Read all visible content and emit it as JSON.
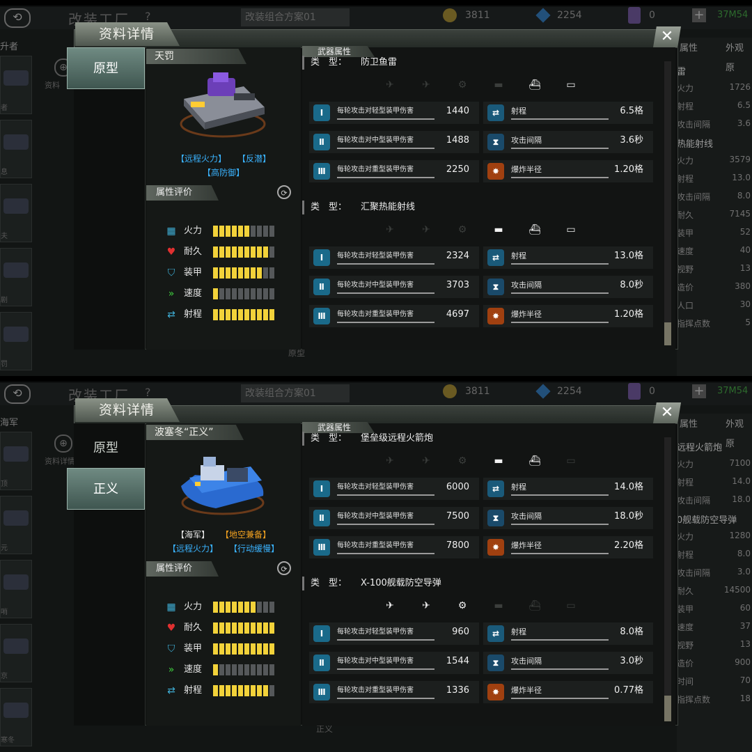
{
  "panels": [
    {
      "background": {
        "title": "改装工厂",
        "help": "?",
        "scheme": "改装组合方案01",
        "coins": "3811",
        "gems": "2254",
        "cards": "0",
        "power": "37M54",
        "filter": "升者",
        "zoom_label": "资料",
        "left_items": [
          "者",
          "息",
          "夫",
          "剧",
          "罚"
        ],
        "right_tabs": [
          "属性",
          "外观原"
        ],
        "right_rows": [
          {
            "k": "雷",
            "v": "",
            "head": true
          },
          {
            "k": "火力",
            "v": "1726"
          },
          {
            "k": "射程",
            "v": "6.5"
          },
          {
            "k": "攻击间隔",
            "v": "3.6"
          },
          {
            "k": "热能射线",
            "v": "",
            "head": true
          },
          {
            "k": "火力",
            "v": "3579"
          },
          {
            "k": "射程",
            "v": "13.0"
          },
          {
            "k": "攻击间隔",
            "v": "8.0"
          },
          {
            "k": "耐久",
            "v": "7145"
          },
          {
            "k": "装甲",
            "v": "52"
          },
          {
            "k": "速度",
            "v": "40"
          },
          {
            "k": "视野",
            "v": "13"
          },
          {
            "k": "造价",
            "v": "380"
          },
          {
            "k": "人口",
            "v": "30"
          },
          {
            "k": "指挥点数",
            "v": "5"
          }
        ],
        "under_label": "原型"
      },
      "dialog": {
        "title": "资料详情",
        "close": "✕",
        "variants": [
          {
            "label": "原型",
            "active": true
          }
        ],
        "unit": {
          "name": "天罚",
          "image": "purple-tank",
          "tags_line1": [
            {
              "text": "【远程火力】",
              "color": "blue"
            },
            {
              "text": "【反潜】",
              "color": "blue"
            }
          ],
          "tags_line2": [
            {
              "text": "【高防御】",
              "color": "blue"
            }
          ]
        },
        "attr_header": "属性评价",
        "attrs": [
          {
            "icon": "firepower-icon",
            "glyph": "▦",
            "label": "火力",
            "value": 6,
            "color": "#3fb0d8"
          },
          {
            "icon": "heart-icon",
            "glyph": "♥",
            "label": "耐久",
            "value": 9,
            "color": "#e03030"
          },
          {
            "icon": "armor-icon",
            "glyph": "⛉",
            "label": "装甲",
            "value": 8,
            "color": "#3fb0d8"
          },
          {
            "icon": "speed-icon",
            "glyph": "»",
            "label": "速度",
            "value": 1,
            "color": "#3fcf3f"
          },
          {
            "icon": "range-icon",
            "glyph": "⇄",
            "label": "射程",
            "value": 10,
            "color": "#3fb0d8"
          }
        ],
        "weapons_header": "武器属性",
        "type_key": "类　型：",
        "weapons": [
          {
            "type": "防卫鱼雷",
            "targets": [
              false,
              false,
              false,
              false,
              true,
              true
            ],
            "stats": [
              {
                "l_label": "每轮攻击对轻型装甲伤害",
                "l_value": "1440",
                "r_icon": "range",
                "r_label": "射程",
                "r_value": "6.5格"
              },
              {
                "l_label": "每轮攻击对中型装甲伤害",
                "l_value": "1488",
                "r_icon": "hourglass",
                "r_label": "攻击间隔",
                "r_value": "3.6秒"
              },
              {
                "l_label": "每轮攻击对重型装甲伤害",
                "l_value": "2250",
                "r_icon": "blast",
                "r_label": "爆炸半径",
                "r_value": "1.20格"
              }
            ]
          },
          {
            "type": "汇聚热能射线",
            "targets": [
              false,
              false,
              false,
              true,
              true,
              true
            ],
            "stats": [
              {
                "l_label": "每轮攻击对轻型装甲伤害",
                "l_value": "2324",
                "r_icon": "range",
                "r_label": "射程",
                "r_value": "13.0格"
              },
              {
                "l_label": "每轮攻击对中型装甲伤害",
                "l_value": "3703",
                "r_icon": "hourglass",
                "r_label": "攻击间隔",
                "r_value": "8.0秒"
              },
              {
                "l_label": "每轮攻击对重型装甲伤害",
                "l_value": "4697",
                "r_icon": "blast",
                "r_label": "爆炸半径",
                "r_value": "1.20格"
              }
            ]
          }
        ]
      }
    },
    {
      "background": {
        "title": "改装工厂",
        "help": "?",
        "scheme": "改装组合方案01",
        "coins": "3811",
        "gems": "2254",
        "cards": "0",
        "power": "37M54",
        "filter": "海军",
        "zoom_label": "资料详情",
        "left_items": [
          "顶",
          "元",
          "哨",
          "京",
          "寒冬"
        ],
        "right_tabs": [
          "属性",
          "外观原"
        ],
        "right_rows": [
          {
            "k": "远程火箭炮",
            "v": "",
            "head": true
          },
          {
            "k": "火力",
            "v": "7100"
          },
          {
            "k": "射程",
            "v": "14.0"
          },
          {
            "k": "攻击间隔",
            "v": "18.0"
          },
          {
            "k": "0舰载防空导弹",
            "v": "",
            "head": true
          },
          {
            "k": "火力",
            "v": "1280"
          },
          {
            "k": "射程",
            "v": "8.0"
          },
          {
            "k": "攻击间隔",
            "v": "3.0"
          },
          {
            "k": "耐久",
            "v": "14500"
          },
          {
            "k": "装甲",
            "v": "60"
          },
          {
            "k": "速度",
            "v": "37"
          },
          {
            "k": "视野",
            "v": "13"
          },
          {
            "k": "造价",
            "v": "900"
          },
          {
            "k": "时间",
            "v": "70"
          },
          {
            "k": "指挥点数",
            "v": "18"
          }
        ],
        "under_label": "正义"
      },
      "dialog": {
        "title": "资料详情",
        "close": "✕",
        "variants": [
          {
            "label": "原型",
            "active": false
          },
          {
            "label": "正义",
            "active": true
          }
        ],
        "unit": {
          "name": "波塞冬“正义”",
          "image": "blue-hovercraft",
          "tags_line1": [
            {
              "text": "【海军】",
              "color": "white"
            },
            {
              "text": "【地空兼备】",
              "color": "orange"
            }
          ],
          "tags_line2": [
            {
              "text": "【远程火力】",
              "color": "blue"
            },
            {
              "text": "【行动缓慢】",
              "color": "blue"
            }
          ]
        },
        "attr_header": "属性评价",
        "attrs": [
          {
            "icon": "firepower-icon",
            "glyph": "▦",
            "label": "火力",
            "value": 7,
            "color": "#3fb0d8"
          },
          {
            "icon": "heart-icon",
            "glyph": "♥",
            "label": "耐久",
            "value": 10,
            "color": "#e03030"
          },
          {
            "icon": "armor-icon",
            "glyph": "⛉",
            "label": "装甲",
            "value": 10,
            "color": "#3fb0d8"
          },
          {
            "icon": "speed-icon",
            "glyph": "»",
            "label": "速度",
            "value": 1,
            "color": "#3fcf3f"
          },
          {
            "icon": "range-icon",
            "glyph": "⇄",
            "label": "射程",
            "value": 9,
            "color": "#3fb0d8"
          }
        ],
        "weapons_header": "武器属性",
        "type_key": "类　型：",
        "weapons": [
          {
            "type": "堡垒级远程火箭炮",
            "targets": [
              false,
              false,
              false,
              true,
              true,
              false
            ],
            "stats": [
              {
                "l_label": "每轮攻击对轻型装甲伤害",
                "l_value": "6000",
                "r_icon": "range",
                "r_label": "射程",
                "r_value": "14.0格"
              },
              {
                "l_label": "每轮攻击对中型装甲伤害",
                "l_value": "7500",
                "r_icon": "hourglass",
                "r_label": "攻击间隔",
                "r_value": "18.0秒"
              },
              {
                "l_label": "每轮攻击对重型装甲伤害",
                "l_value": "7800",
                "r_icon": "blast",
                "r_label": "爆炸半径",
                "r_value": "2.20格"
              }
            ]
          },
          {
            "type": "X-100舰载防空导弹",
            "targets": [
              true,
              true,
              true,
              false,
              false,
              false
            ],
            "stats": [
              {
                "l_label": "每轮攻击对轻型装甲伤害",
                "l_value": "960",
                "r_icon": "range",
                "r_label": "射程",
                "r_value": "8.0格"
              },
              {
                "l_label": "每轮攻击对中型装甲伤害",
                "l_value": "1544",
                "r_icon": "hourglass",
                "r_label": "攻击间隔",
                "r_value": "3.0秒"
              },
              {
                "l_label": "每轮攻击对重型装甲伤害",
                "l_value": "1336",
                "r_icon": "blast",
                "r_label": "爆炸半径",
                "r_value": "0.77格"
              }
            ]
          }
        ]
      }
    }
  ],
  "target_icons": [
    {
      "name": "fighter-jet-icon",
      "glyph": "✈"
    },
    {
      "name": "bomber-icon",
      "glyph": "✈"
    },
    {
      "name": "helicopter-icon",
      "glyph": "⚙"
    },
    {
      "name": "tank-icon",
      "glyph": "▬"
    },
    {
      "name": "ship-icon",
      "glyph": "⛴"
    },
    {
      "name": "submarine-icon",
      "glyph": "▭"
    }
  ],
  "stat_icon_glyphs": {
    "shield-l": "Ⅰ",
    "shield-m": "Ⅱ",
    "shield-h": "Ⅲ",
    "range": "⇄",
    "hourglass": "⧗",
    "blast": "✸"
  },
  "scroll": [
    {
      "thumb_start": 0.92,
      "thumb_end": 1.0
    },
    {
      "thumb_start": 0.91,
      "thumb_end": 1.0
    }
  ]
}
